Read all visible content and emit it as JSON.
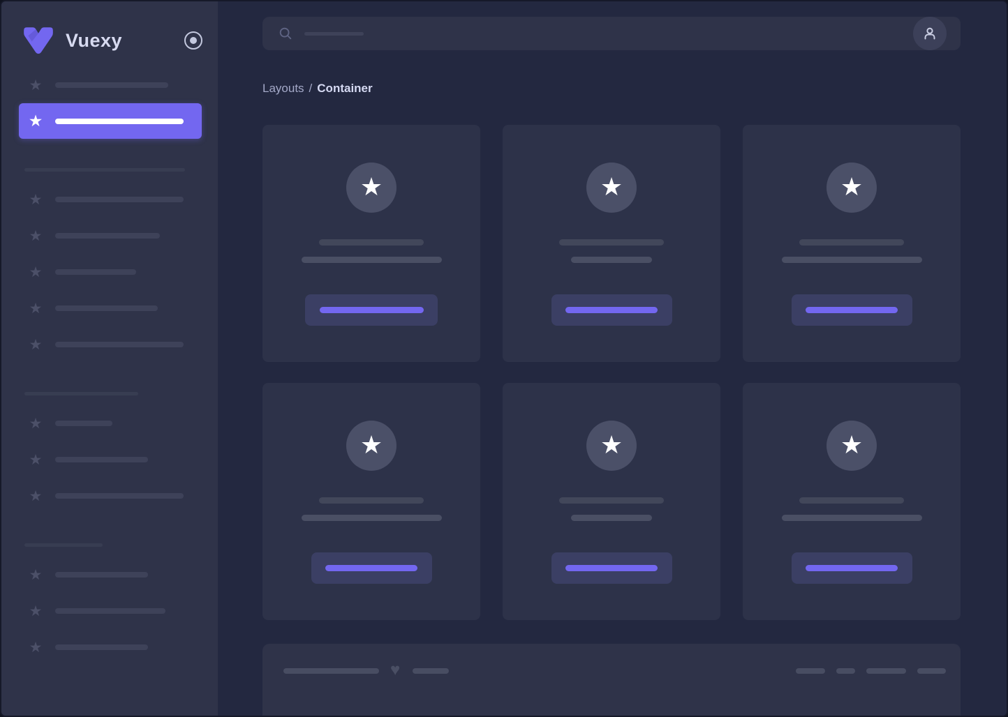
{
  "theme": {
    "accent": "#7367f0",
    "sidebar_bg": "#2f3349",
    "content_bg": "#232840",
    "card_bg": "#2d3249",
    "panel_bg": "#2f3349",
    "button_bg": "#3b3f64",
    "skeleton": "#454a5f",
    "skeleton_dim": "#3e4259",
    "text_bright": "#d7daf0",
    "text_muted": "#a4a9c8"
  },
  "brand": {
    "name": "Vuexy",
    "logo_icon": "vuexy-v-logo",
    "toggle_icon": "radio-circle-icon"
  },
  "header": {
    "search_icon": "search-icon",
    "avatar_icon": "person-icon"
  },
  "breadcrumb": {
    "parent": "Layouts",
    "separator": "/",
    "current": "Container"
  },
  "icons": {
    "star": "★",
    "heart": "♥"
  }
}
